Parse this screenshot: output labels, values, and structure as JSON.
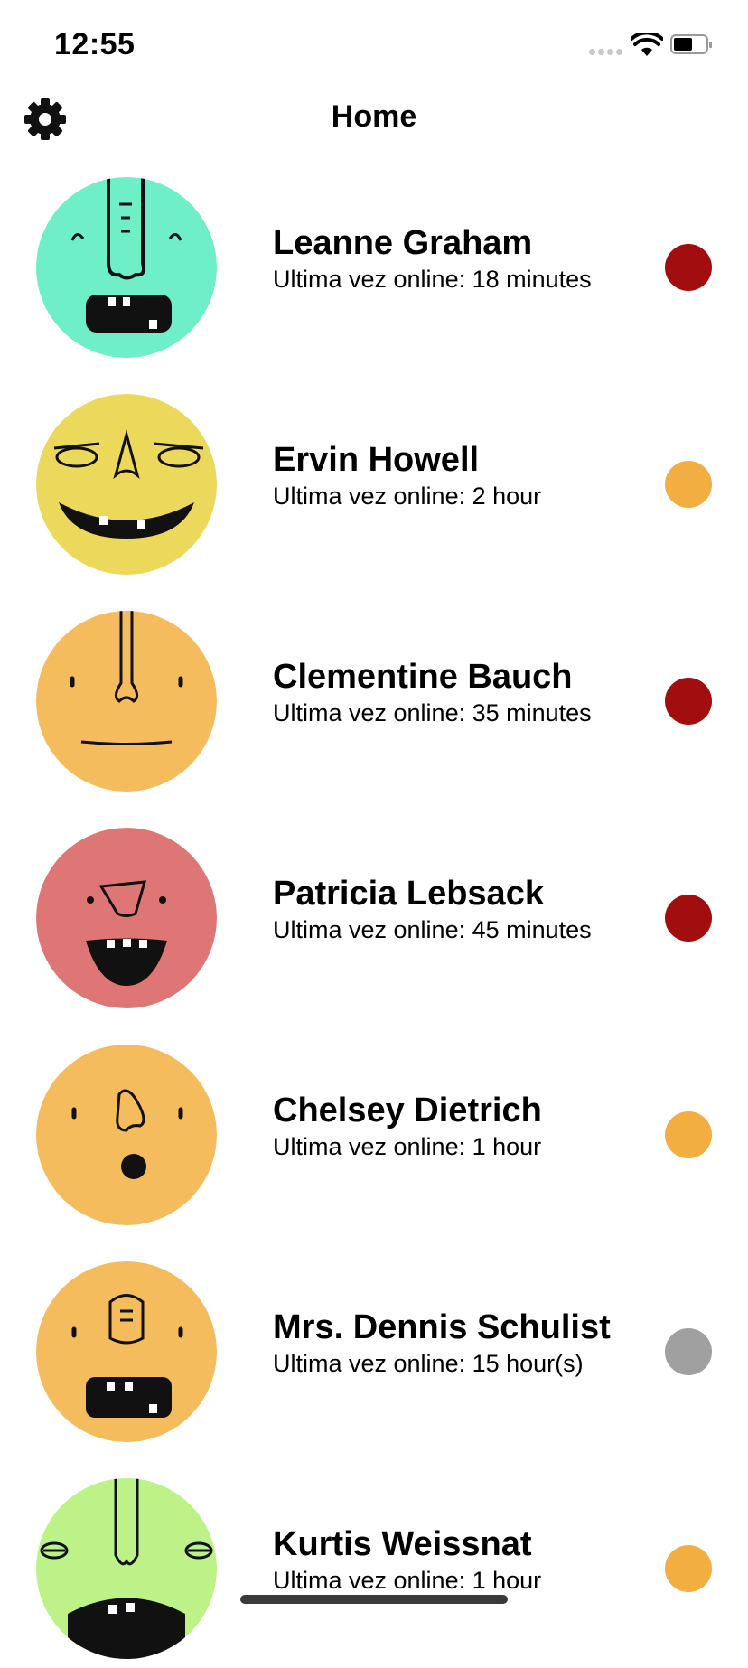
{
  "status_bar": {
    "time": "12:55"
  },
  "header": {
    "title": "Home",
    "settings_icon": "gear-icon"
  },
  "colors": {
    "online_red": "#a20e10",
    "online_orange": "#f2ae41",
    "online_gray": "#a0a0a0"
  },
  "users": [
    {
      "name": "Leanne Graham",
      "last_online": "Ultima vez online: 18 minutes",
      "avatar_color": "#6fefc7",
      "status_color": "#a20e10"
    },
    {
      "name": "Ervin Howell",
      "last_online": "Ultima vez online: 2 hour",
      "avatar_color": "#ecd95b",
      "status_color": "#f2ae41"
    },
    {
      "name": "Clementine Bauch",
      "last_online": "Ultima vez online: 35 minutes",
      "avatar_color": "#f4bc5c",
      "status_color": "#a20e10"
    },
    {
      "name": "Patricia Lebsack",
      "last_online": "Ultima vez online: 45 minutes",
      "avatar_color": "#df7676",
      "status_color": "#a20e10"
    },
    {
      "name": "Chelsey Dietrich",
      "last_online": "Ultima vez online: 1 hour",
      "avatar_color": "#f4bc5c",
      "status_color": "#f2ae41"
    },
    {
      "name": "Mrs. Dennis Schulist",
      "last_online": "Ultima vez online: 15 hour(s)",
      "avatar_color": "#f4bc5c",
      "status_color": "#a0a0a0"
    },
    {
      "name": "Kurtis Weissnat",
      "last_online": "Ultima vez online: 1 hour",
      "avatar_color": "#bdf289",
      "status_color": "#f2ae41"
    }
  ]
}
